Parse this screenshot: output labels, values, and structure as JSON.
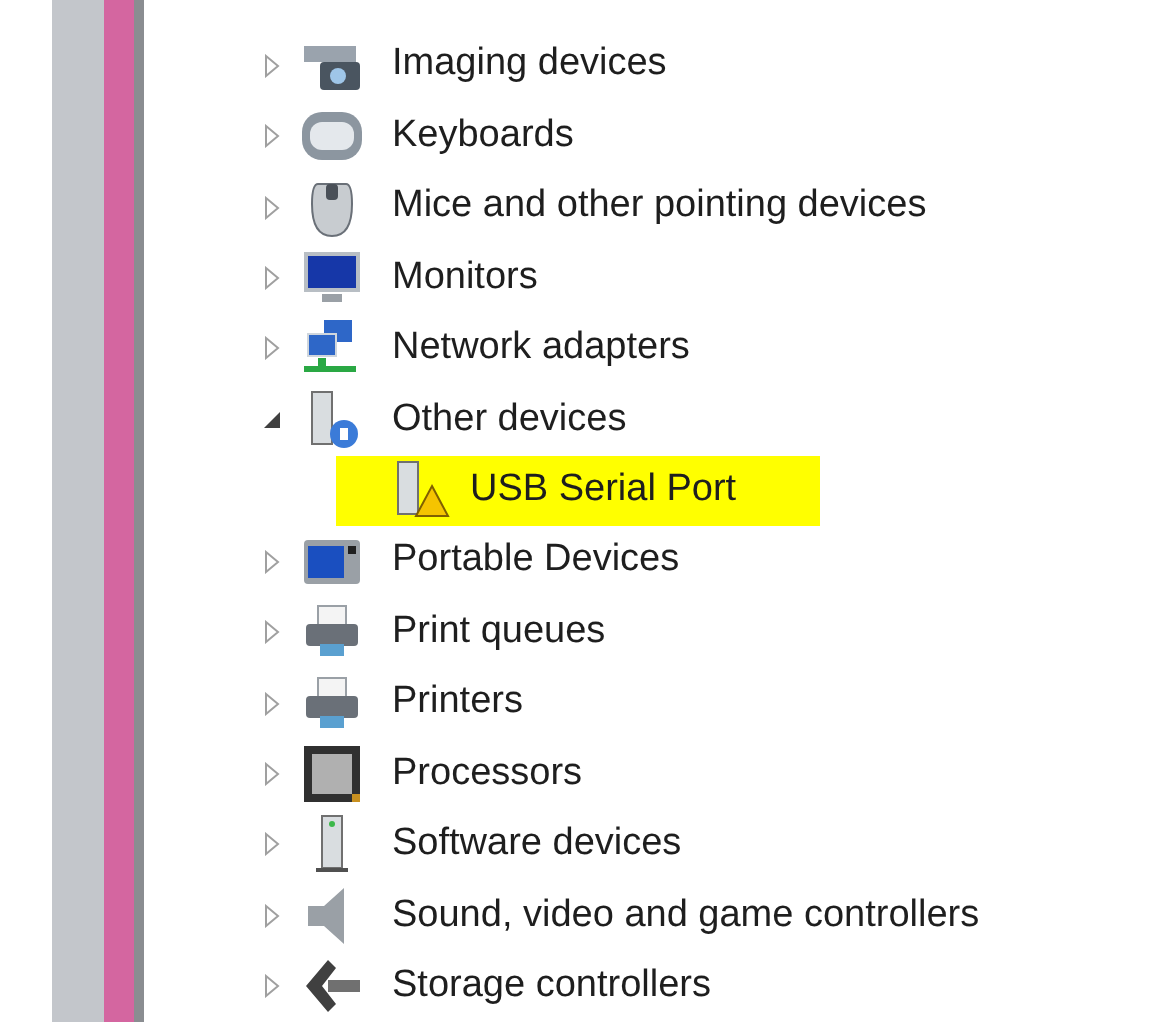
{
  "tree": {
    "items": [
      {
        "label": "Imaging devices",
        "expanded": false
      },
      {
        "label": "Keyboards",
        "expanded": false
      },
      {
        "label": "Mice and other pointing devices",
        "expanded": false
      },
      {
        "label": "Monitors",
        "expanded": false
      },
      {
        "label": "Network adapters",
        "expanded": false
      },
      {
        "label": "Other devices",
        "expanded": true,
        "children": [
          {
            "label": "USB Serial Port",
            "highlighted": true
          }
        ]
      },
      {
        "label": "Portable Devices",
        "expanded": false
      },
      {
        "label": "Print queues",
        "expanded": false
      },
      {
        "label": "Printers",
        "expanded": false
      },
      {
        "label": "Processors",
        "expanded": false
      },
      {
        "label": "Software devices",
        "expanded": false
      },
      {
        "label": "Sound, video and game controllers",
        "expanded": false
      },
      {
        "label": "Storage controllers",
        "expanded": false
      }
    ]
  }
}
